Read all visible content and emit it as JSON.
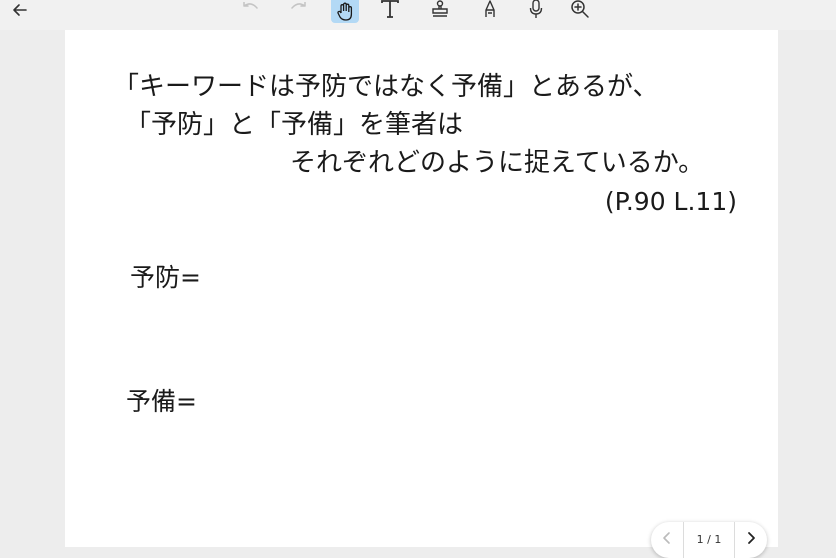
{
  "toolbar": {
    "icons": [
      "back-arrow-icon",
      "undo-icon",
      "redo-icon",
      "hand-icon",
      "text-icon",
      "stamp-icon",
      "pen-icon",
      "mic-icon",
      "zoom-in-icon"
    ],
    "active_tool": "hand-icon",
    "active_color": "#b3d9f5"
  },
  "document": {
    "question_line1": "「キーワードは予防ではなく予備」とあるが、",
    "question_line2": "「予防」と「予備」を筆者は",
    "question_line3": "それぞれどのように捉えているか。",
    "reference": "(P.90 L.11)",
    "label_prevention": "予防=",
    "label_preparation": "予備="
  },
  "pager": {
    "indicator": "1 / 1"
  }
}
